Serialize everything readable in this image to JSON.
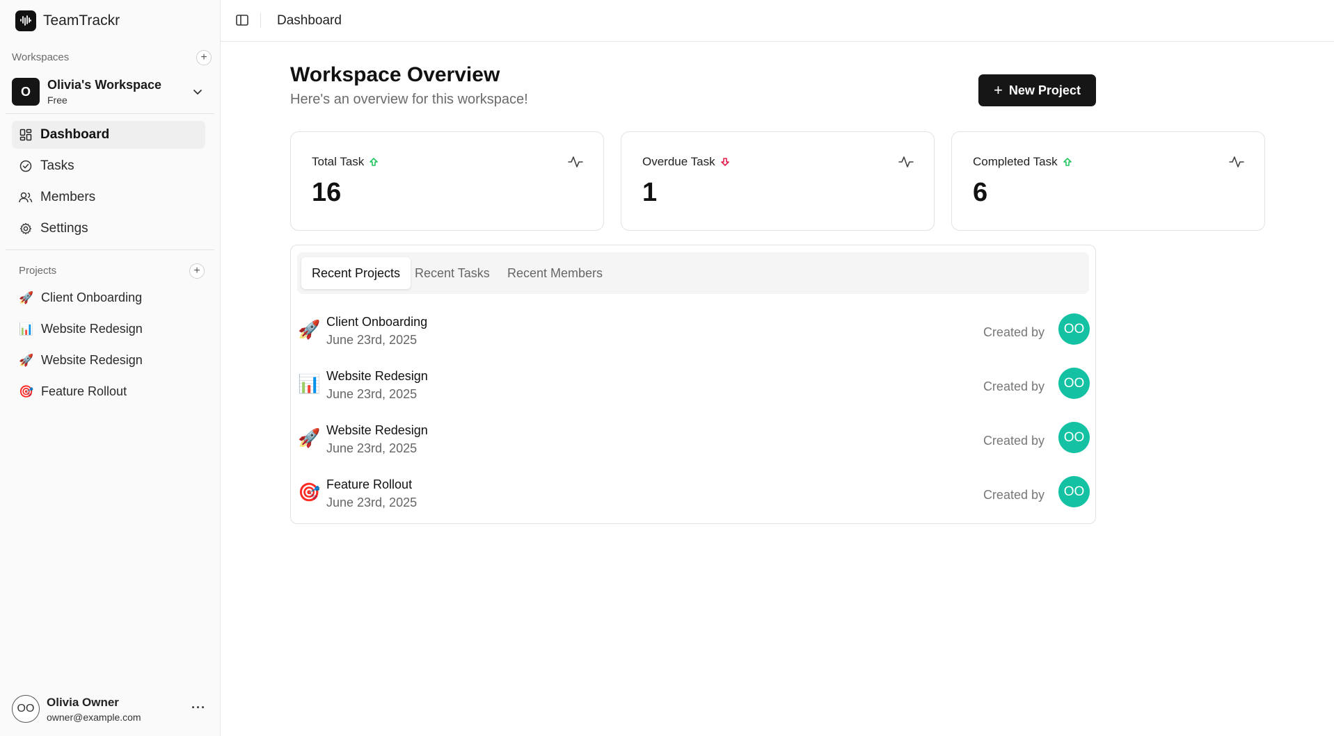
{
  "brand": {
    "name": "TeamTrackr"
  },
  "sidebar": {
    "workspaces_label": "Workspaces",
    "workspace": {
      "initial": "O",
      "name": "Olivia's Workspace",
      "plan": "Free"
    },
    "nav": [
      {
        "label": "Dashboard",
        "icon": "dashboard-icon",
        "active": true
      },
      {
        "label": "Tasks",
        "icon": "check-circle-icon",
        "active": false
      },
      {
        "label": "Members",
        "icon": "users-icon",
        "active": false
      },
      {
        "label": "Settings",
        "icon": "gear-icon",
        "active": false
      }
    ],
    "projects_label": "Projects",
    "projects": [
      {
        "emoji": "🚀",
        "name": "Client Onboarding"
      },
      {
        "emoji": "📊",
        "name": "Website Redesign"
      },
      {
        "emoji": "🚀",
        "name": "Website Redesign"
      },
      {
        "emoji": "🎯",
        "name": "Feature Rollout"
      }
    ],
    "user": {
      "initials": "OO",
      "name": "Olivia Owner",
      "email": "owner@example.com",
      "more": "···"
    }
  },
  "topbar": {
    "breadcrumb": "Dashboard"
  },
  "page": {
    "title": "Workspace Overview",
    "subtitle": "Here's an overview for this workspace!",
    "new_project_label": "New Project"
  },
  "stats": [
    {
      "title": "Total Task",
      "value": "16",
      "trend": "up"
    },
    {
      "title": "Overdue Task",
      "value": "1",
      "trend": "down"
    },
    {
      "title": "Completed Task",
      "value": "6",
      "trend": "up"
    }
  ],
  "tabs": [
    {
      "label": "Recent Projects",
      "active": true
    },
    {
      "label": "Recent Tasks",
      "active": false
    },
    {
      "label": "Recent Members",
      "active": false
    }
  ],
  "recent_projects": [
    {
      "emoji": "🚀",
      "name": "Client Onboarding",
      "date": "June 23rd, 2025",
      "created_by_label": "Created by",
      "avatar": "OO"
    },
    {
      "emoji": "📊",
      "name": "Website Redesign",
      "date": "June 23rd, 2025",
      "created_by_label": "Created by",
      "avatar": "OO"
    },
    {
      "emoji": "🚀",
      "name": "Website Redesign",
      "date": "June 23rd, 2025",
      "created_by_label": "Created by",
      "avatar": "OO"
    },
    {
      "emoji": "🎯",
      "name": "Feature Rollout",
      "date": "June 23rd, 2025",
      "created_by_label": "Created by",
      "avatar": "OO"
    }
  ],
  "colors": {
    "trend_up": "#22c55e",
    "trend_down": "#e11d48",
    "avatar_bg": "#14c2a3",
    "primary_button": "#161616"
  }
}
